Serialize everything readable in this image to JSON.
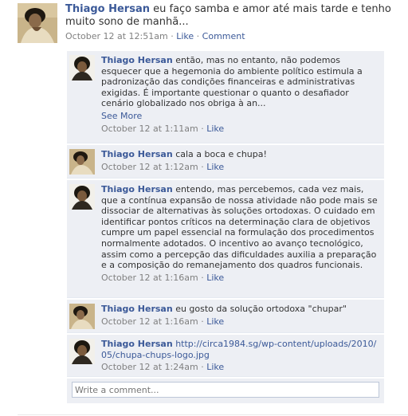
{
  "post": {
    "author": "Thiago Hersan",
    "text": "eu faço samba e amor até mais tarde e tenho muito sono de manhã...",
    "timestamp": "October 12 at 12:51am",
    "like_label": "Like",
    "comment_label": "Comment",
    "separator": " · "
  },
  "comments": [
    {
      "author": "Thiago Hersan",
      "text": "então, mas no entanto, não podemos esquecer que a hegemonia do ambiente político estimula a padronização das condições financeiras e administrativas exigidas. É importante questionar o quanto o desafiador cenário globalizado nos obriga à an...",
      "see_more": "See More",
      "timestamp": "October 12 at 1:11am",
      "like_label": "Like"
    },
    {
      "author": "Thiago Hersan",
      "text": "cala a boca e chupa!",
      "timestamp": "October 12 at 1:12am",
      "like_label": "Like"
    },
    {
      "author": "Thiago Hersan",
      "text": "entendo, mas percebemos, cada vez mais, que a contínua expansão de nossa atividade não pode mais se dissociar de alternativas às soluções ortodoxas. O cuidado em identificar pontos críticos na determinação clara de objetivos cumpre um papel essencial na formulação dos procedimentos normalmente adotados. O incentivo ao avanço tecnológico, assim como a percepção das dificuldades auxilia a preparação e a composição do remanejamento dos quadros funcionais.",
      "timestamp": "October 12 at 1:16am",
      "like_label": "Like"
    },
    {
      "author": "Thiago Hersan",
      "text": "eu gosto da solução ortodoxa \"chupar\"",
      "timestamp": "October 12 at 1:16am",
      "like_label": "Like"
    },
    {
      "author": "Thiago Hersan",
      "link": "http://circa1984.sg/wp-content/uploads/2010/05/chupa-chups-logo.jpg",
      "timestamp": "October 12 at 1:24am",
      "like_label": "Like"
    }
  ],
  "write_comment": {
    "placeholder": "Write a comment..."
  },
  "colors": {
    "link": "#3b5998",
    "meta": "#808080",
    "comment_bg": "#edeff4",
    "input_border": "#bdc7d8"
  },
  "icons": {
    "avatar": "profile-photo"
  }
}
